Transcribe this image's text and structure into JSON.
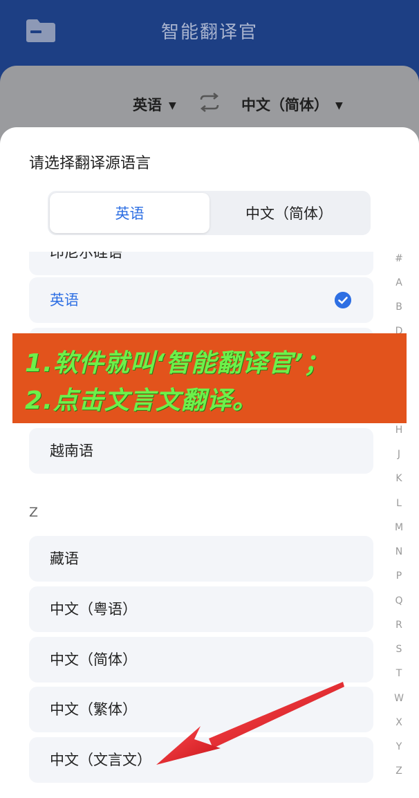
{
  "app": {
    "title": "智能翻译官"
  },
  "header": {
    "source_lang": "英语",
    "target_lang": "中文（简体）"
  },
  "sheet": {
    "title": "请选择翻译源语言",
    "tabs": [
      "英语",
      "中文（简体）"
    ]
  },
  "list": {
    "partial_top": "印尼尔硅语",
    "selected": "英语",
    "vietnamese": "越南语",
    "section_z": "Z",
    "z_items": [
      "藏语",
      "中文（粤语）",
      "中文（简体）",
      "中文（繁体）",
      "中文（文言文）"
    ]
  },
  "alpha_index": [
    "#",
    "A",
    "B",
    "D",
    "H",
    "J",
    "K",
    "L",
    "M",
    "N",
    "P",
    "Q",
    "R",
    "S",
    "T",
    "W",
    "X",
    "Y",
    "Z"
  ],
  "annotation": {
    "line1": "1.软件就叫‘智能翻译官’；",
    "line2": "2.点击文言文翻译。"
  },
  "colors": {
    "accent": "#2e6fe3",
    "appbar": "#1d3f84",
    "banner": "#e2531c",
    "banner_text": "#6df04a",
    "arrow": "#e8242a"
  }
}
